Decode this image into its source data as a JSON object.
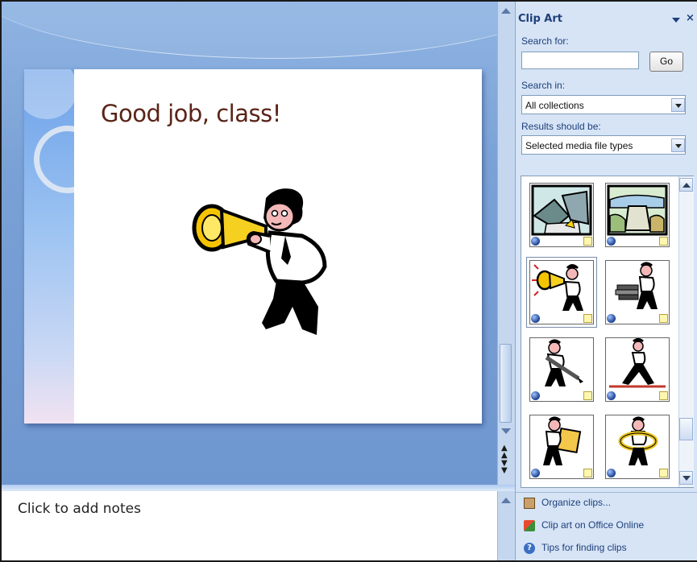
{
  "slide": {
    "title": "Good job, class!"
  },
  "notes": {
    "placeholder": "Click to add notes"
  },
  "task_pane": {
    "title": "Clip Art",
    "search_for_label": "Search for:",
    "search_value": "",
    "go_label": "Go",
    "search_in_label": "Search in:",
    "search_in_value": "All collections",
    "results_label": "Results should be:",
    "results_value": "Selected media file types",
    "links": [
      {
        "label": "Organize clips...",
        "icon": "organize-clips-icon"
      },
      {
        "label": "Clip art on Office Online",
        "icon": "office-online-icon"
      },
      {
        "label": "Tips for finding clips",
        "icon": "help-icon"
      }
    ]
  },
  "clips": [
    {
      "name": "dam-drawing-clip"
    },
    {
      "name": "dam-landscape-clip"
    },
    {
      "name": "man-megaphone-clip",
      "selected": true
    },
    {
      "name": "man-books-clip"
    },
    {
      "name": "man-pen-clip"
    },
    {
      "name": "man-tightrope-clip"
    },
    {
      "name": "man-chart-clip"
    },
    {
      "name": "man-lifebuoy-clip"
    }
  ],
  "colors": {
    "pane_bg": "#d6e4f6",
    "workspace_bg": "#7aa1d6",
    "title_text": "#5a2418",
    "pane_text": "#1e3f7a"
  }
}
